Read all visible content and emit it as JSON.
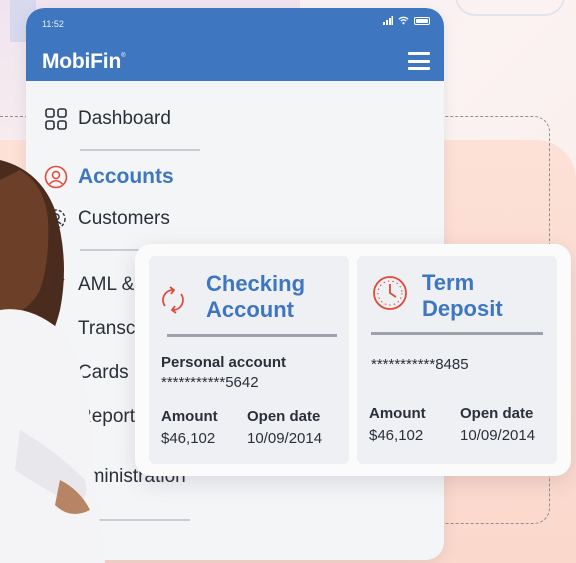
{
  "status_bar": {
    "time": "11:52"
  },
  "header": {
    "brand": "MobiFin",
    "brand_mark": "®"
  },
  "menu": {
    "items": [
      {
        "label": "Dashboard",
        "icon": "grid-icon"
      },
      {
        "label": "Accounts",
        "icon": "user-circle-icon",
        "active": true
      },
      {
        "label": "Customers",
        "icon": "customers-icon"
      },
      {
        "label": "AML &",
        "icon": "aml-icon"
      },
      {
        "label": "Transc",
        "icon": "transactions-icon"
      },
      {
        "label": "Cards",
        "icon": "cards-icon"
      },
      {
        "label": "Report",
        "icon": "reports-icon"
      },
      {
        "label": "dministration",
        "icon": "admin-icon"
      }
    ]
  },
  "cards": {
    "checking": {
      "title_line1": "Checking",
      "title_line2": "Account",
      "type_label": "Personal account",
      "account_number": "***********5642",
      "amount_label": "Amount",
      "amount_value": "$46,102",
      "open_date_label": "Open date",
      "open_date_value": "10/09/2014",
      "icon": "refresh-icon"
    },
    "term": {
      "title_line1": "Term",
      "title_line2": "Deposit",
      "account_number": "***********8485",
      "amount_label": "Amount",
      "amount_value": "$46,102",
      "open_date_label": "Open date",
      "open_date_value": "10/09/2014",
      "icon": "clock-icon"
    }
  },
  "colors": {
    "brand_blue": "#3e76bf",
    "icon_red": "#e04a3a",
    "panel_bg": "#f4f5f7"
  }
}
